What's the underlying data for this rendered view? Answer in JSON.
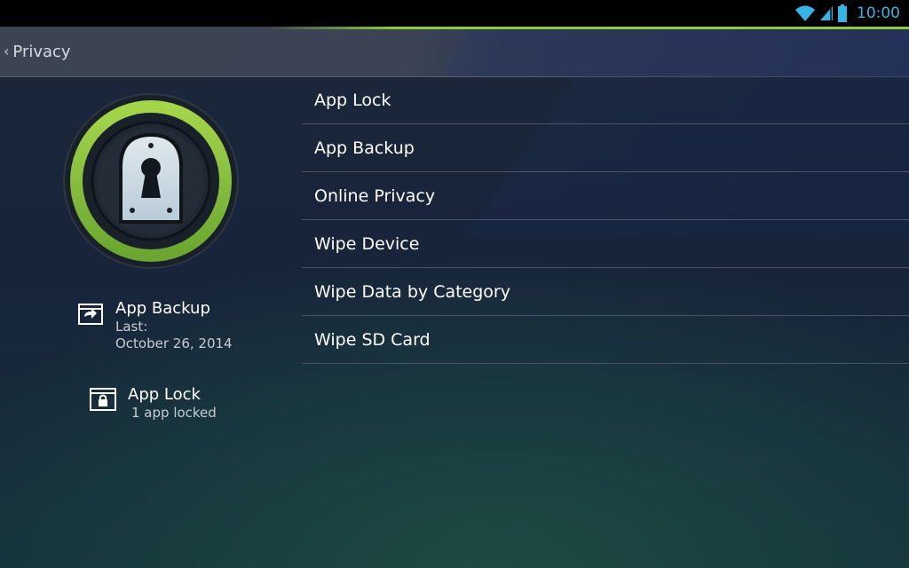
{
  "status_bar": {
    "time": "10:00",
    "icons": [
      "wifi-icon",
      "signal-icon",
      "battery-icon"
    ],
    "accent_color": "#33b5e5"
  },
  "action_bar": {
    "back_chevron": "‹",
    "title": "Privacy",
    "accent_color": "#8ccc3c"
  },
  "left_panel": {
    "shield_icon": "keyhole-lock-icon",
    "app_backup": {
      "title": "App Backup",
      "last_label": "Last:",
      "date": "October 26, 2014"
    },
    "app_lock": {
      "title": "App Lock",
      "status": "1 app locked"
    }
  },
  "menu": {
    "items": [
      {
        "label": "App Lock"
      },
      {
        "label": "App Backup"
      },
      {
        "label": "Online Privacy"
      },
      {
        "label": "Wipe Device"
      },
      {
        "label": "Wipe Data by Category"
      },
      {
        "label": "Wipe SD Card"
      }
    ]
  }
}
